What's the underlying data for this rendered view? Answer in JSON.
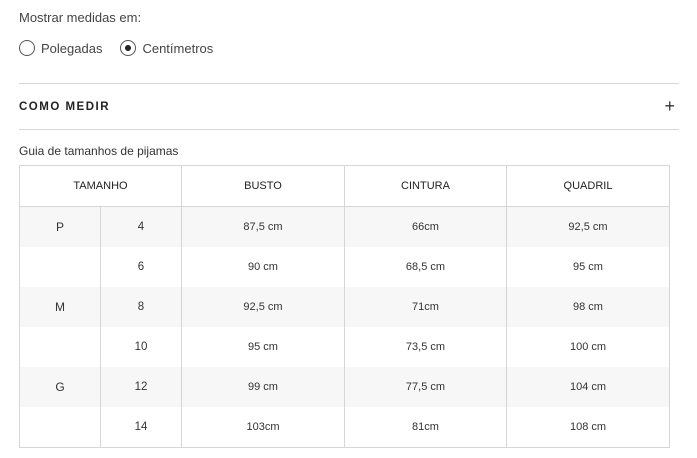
{
  "units": {
    "label": "Mostrar medidas em:",
    "options": [
      {
        "label": "Polegadas",
        "selected": false
      },
      {
        "label": "Centímetros",
        "selected": true
      }
    ]
  },
  "accordion": {
    "title": "COMO MEDIR",
    "icon": "plus-icon",
    "expand_symbol": "+"
  },
  "guide": {
    "title": "Guia de tamanhos de pijamas",
    "headers": [
      "TAMANHO",
      "BUSTO",
      "CINTURA",
      "QUADRIL"
    ],
    "rows": [
      {
        "letter": "P",
        "size": "4",
        "busto": "87,5 cm",
        "cintura": "66cm",
        "quadril": "92,5 cm"
      },
      {
        "letter": "",
        "size": "6",
        "busto": "90 cm",
        "cintura": "68,5 cm",
        "quadril": "95 cm"
      },
      {
        "letter": "M",
        "size": "8",
        "busto": "92,5 cm",
        "cintura": "71cm",
        "quadril": "98 cm"
      },
      {
        "letter": "",
        "size": "10",
        "busto": "95 cm",
        "cintura": "73,5 cm",
        "quadril": "100 cm"
      },
      {
        "letter": "G",
        "size": "12",
        "busto": "99 cm",
        "cintura": "77,5 cm",
        "quadril": "104 cm"
      },
      {
        "letter": "",
        "size": "14",
        "busto": "103cm",
        "cintura": "81cm",
        "quadril": "108 cm"
      }
    ]
  }
}
